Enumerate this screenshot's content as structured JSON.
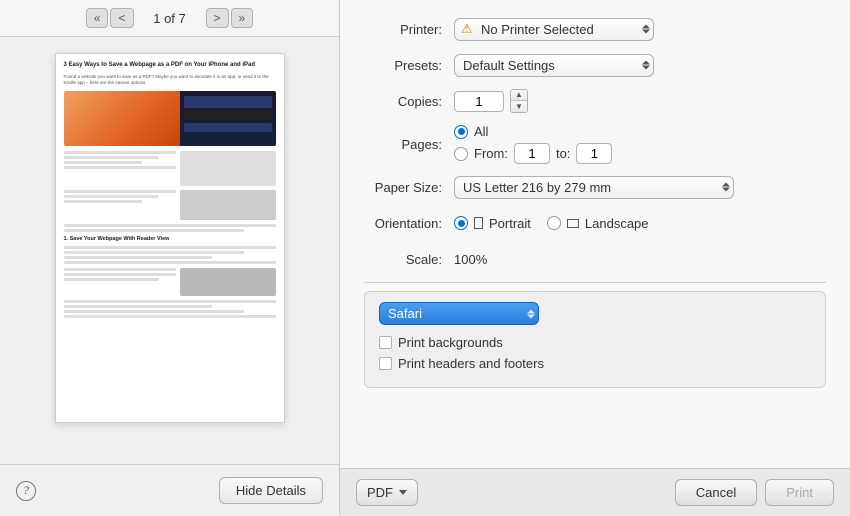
{
  "toolbar": {
    "first_prev_label": "«|<",
    "page_indicator": "1 of 7",
    "next_last_label": "> »"
  },
  "preview": {
    "title": "3 Easy Ways to Save a Webpage as a PDF on Your iPhone and iPad"
  },
  "bottom_left": {
    "help_label": "?",
    "hide_details_label": "Hide Details"
  },
  "print_form": {
    "printer_label": "Printer:",
    "printer_value": "No Printer Selected",
    "presets_label": "Presets:",
    "presets_value": "Default Settings",
    "copies_label": "Copies:",
    "copies_value": "1",
    "pages_label": "Pages:",
    "pages_all_label": "All",
    "pages_from_label": "From:",
    "pages_from_value": "1",
    "pages_to_label": "to:",
    "pages_to_value": "1",
    "paper_size_label": "Paper Size:",
    "paper_size_value": "US Letter  216 by 279 mm",
    "orientation_label": "Orientation:",
    "portrait_label": "Portrait",
    "landscape_label": "Landscape",
    "scale_label": "Scale:",
    "scale_value": "100%"
  },
  "safari_section": {
    "dropdown_label": "Safari",
    "print_backgrounds_label": "Print backgrounds",
    "print_headers_label": "Print headers and footers"
  },
  "bottom_bar": {
    "pdf_label": "PDF",
    "cancel_label": "Cancel",
    "print_label": "Print"
  }
}
